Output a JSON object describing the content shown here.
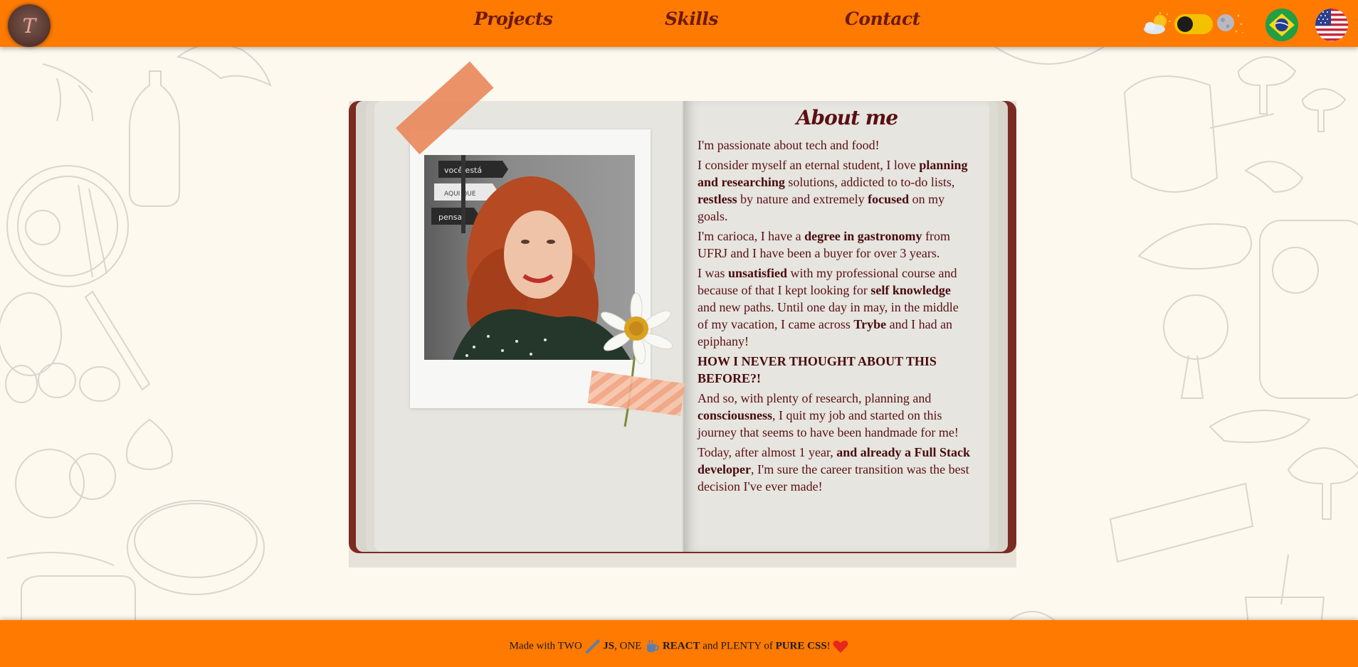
{
  "header": {
    "logo_letter": "T",
    "nav": [
      {
        "label": "Projects"
      },
      {
        "label": "Skills"
      },
      {
        "label": "Contact"
      }
    ]
  },
  "about": {
    "title": "About me",
    "paragraphs": {
      "p1": "I'm passionate about tech and food!",
      "p2_a": "I consider myself an eternal student, I love ",
      "p2_b": "planning and researching",
      "p2_c": " solutions, addicted to to-do lists, ",
      "p2_d": "restless",
      "p2_e": " by nature and extremely ",
      "p2_f": "focused",
      "p2_g": " on my goals.",
      "p3_a": "I'm carioca, I have a ",
      "p3_b": "degree in gastronomy",
      "p3_c": " from UFRJ and I have been a buyer for over 3 years.",
      "p4_a": "I was ",
      "p4_b": "unsatisfied",
      "p4_c": " with my professional course and because of that I kept looking for ",
      "p4_d": "self knowledge",
      "p4_e": " and new paths. Until one day in may, in the middle of my vacation, I came across ",
      "p4_f": "Trybe",
      "p4_g": " and I had an epiphany!",
      "p5": "HOW I NEVER THOUGHT ABOUT THIS BEFORE?!",
      "p6_a": "And so, with plenty of research, planning and ",
      "p6_b": "consciousness",
      "p6_c": ", I quit my job and started on this journey that seems to have been handmade for me!",
      "p7_a": "Today, after almost 1 year, ",
      "p7_b": "and already a Full Stack developer",
      "p7_c": ", I'm sure the career transition was the best decision I've ever made!"
    }
  },
  "photo": {
    "sign_texts": [
      "você está",
      "AQUI QUE",
      "pensa"
    ]
  },
  "footer": {
    "t1": "Made with TWO ",
    "t2": "JS",
    "t3": ", ONE ",
    "t4": "REACT",
    "t5": " and PLENTY of ",
    "t6": "PURE CSS",
    "t7": "! "
  },
  "colors": {
    "header": "#ff7a00",
    "text": "#5a0f14",
    "book_cover": "#7a2c22",
    "page": "#e6e5df",
    "toggle": "#f2c200"
  },
  "icons": [
    "sun-cloud-icon",
    "moon-stars-icon",
    "brazil-flag-icon",
    "usa-flag-icon",
    "rolling-pin-icon",
    "cup-icon",
    "heart-icon"
  ]
}
